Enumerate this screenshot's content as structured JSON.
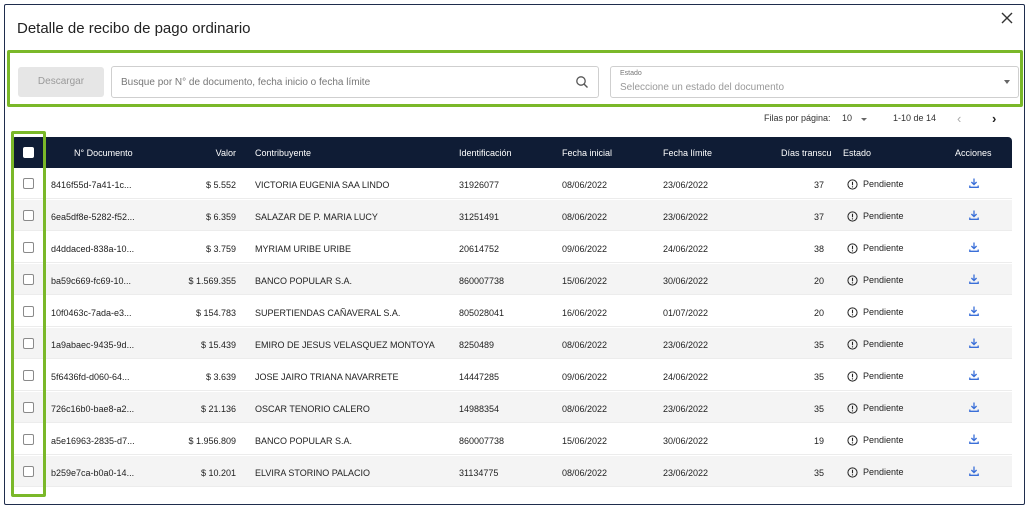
{
  "dialog": {
    "title": "Detalle de recibo de pago ordinario",
    "close_icon": "close-icon"
  },
  "filters": {
    "download_label": "Descargar",
    "search_placeholder": "Busque por N° de documento, fecha inicio o fecha límite",
    "estado_label": "Estado",
    "estado_placeholder": "Seleccione un estado del documento"
  },
  "pagination": {
    "rows_per_page_label": "Filas por página:",
    "rows_per_page_value": "10",
    "range": "1-10 de 14",
    "prev": "‹",
    "next": "›"
  },
  "table": {
    "headers": {
      "documento": "N° Documento",
      "valor": "Valor",
      "contribuyente": "Contribuyente",
      "identificacion": "Identificación",
      "fecha_inicial": "Fecha inicial",
      "fecha_limite": "Fecha límite",
      "dias": "Días transcu",
      "estado": "Estado",
      "acciones": "Acciones"
    },
    "rows": [
      {
        "documento": "8416f55d-7a41-1c...",
        "valor": "$ 5.552",
        "contribuyente": "VICTORIA EUGENIA SAA LINDO",
        "identificacion": "31926077",
        "fecha_inicial": "08/06/2022",
        "fecha_limite": "23/06/2022",
        "dias": "37",
        "estado": "Pendiente"
      },
      {
        "documento": "6ea5df8e-5282-f52...",
        "valor": "$ 6.359",
        "contribuyente": "SALAZAR DE P. MARIA LUCY",
        "identificacion": "31251491",
        "fecha_inicial": "08/06/2022",
        "fecha_limite": "23/06/2022",
        "dias": "37",
        "estado": "Pendiente"
      },
      {
        "documento": "d4ddaced-838a-10...",
        "valor": "$ 3.759",
        "contribuyente": "MYRIAM URIBE URIBE",
        "identificacion": "20614752",
        "fecha_inicial": "09/06/2022",
        "fecha_limite": "24/06/2022",
        "dias": "38",
        "estado": "Pendiente"
      },
      {
        "documento": "ba59c669-fc69-10...",
        "valor": "$ 1.569.355",
        "contribuyente": "BANCO POPULAR S.A.",
        "identificacion": "860007738",
        "fecha_inicial": "15/06/2022",
        "fecha_limite": "30/06/2022",
        "dias": "20",
        "estado": "Pendiente"
      },
      {
        "documento": "10f0463c-7ada-e3...",
        "valor": "$ 154.783",
        "contribuyente": "SUPERTIENDAS CAÑAVERAL S.A.",
        "identificacion": "805028041",
        "fecha_inicial": "16/06/2022",
        "fecha_limite": "01/07/2022",
        "dias": "20",
        "estado": "Pendiente"
      },
      {
        "documento": "1a9abaec-9435-9d...",
        "valor": "$ 15.439",
        "contribuyente": "EMIRO DE JESUS VELASQUEZ MONTOYA",
        "identificacion": "8250489",
        "fecha_inicial": "08/06/2022",
        "fecha_limite": "23/06/2022",
        "dias": "35",
        "estado": "Pendiente"
      },
      {
        "documento": "5f6436fd-d060-64...",
        "valor": "$ 3.639",
        "contribuyente": "JOSE JAIRO TRIANA NAVARRETE",
        "identificacion": "14447285",
        "fecha_inicial": "09/06/2022",
        "fecha_limite": "24/06/2022",
        "dias": "35",
        "estado": "Pendiente"
      },
      {
        "documento": "726c16b0-bae8-a2...",
        "valor": "$ 21.136",
        "contribuyente": "OSCAR TENORIO CALERO",
        "identificacion": "14988354",
        "fecha_inicial": "08/06/2022",
        "fecha_limite": "23/06/2022",
        "dias": "35",
        "estado": "Pendiente"
      },
      {
        "documento": "a5e16963-2835-d7...",
        "valor": "$ 1.956.809",
        "contribuyente": "BANCO POPULAR S.A.",
        "identificacion": "860007738",
        "fecha_inicial": "15/06/2022",
        "fecha_limite": "30/06/2022",
        "dias": "19",
        "estado": "Pendiente"
      },
      {
        "documento": "b259e7ca-b0a0-14...",
        "valor": "$ 10.201",
        "contribuyente": "ELVIRA STORINO PALACIO",
        "identificacion": "31134775",
        "fecha_inicial": "08/06/2022",
        "fecha_limite": "23/06/2022",
        "dias": "35",
        "estado": "Pendiente"
      }
    ]
  },
  "colors": {
    "header_bg": "#0f1c35",
    "highlight": "#7ab829",
    "action_icon": "#3a6fd8"
  }
}
